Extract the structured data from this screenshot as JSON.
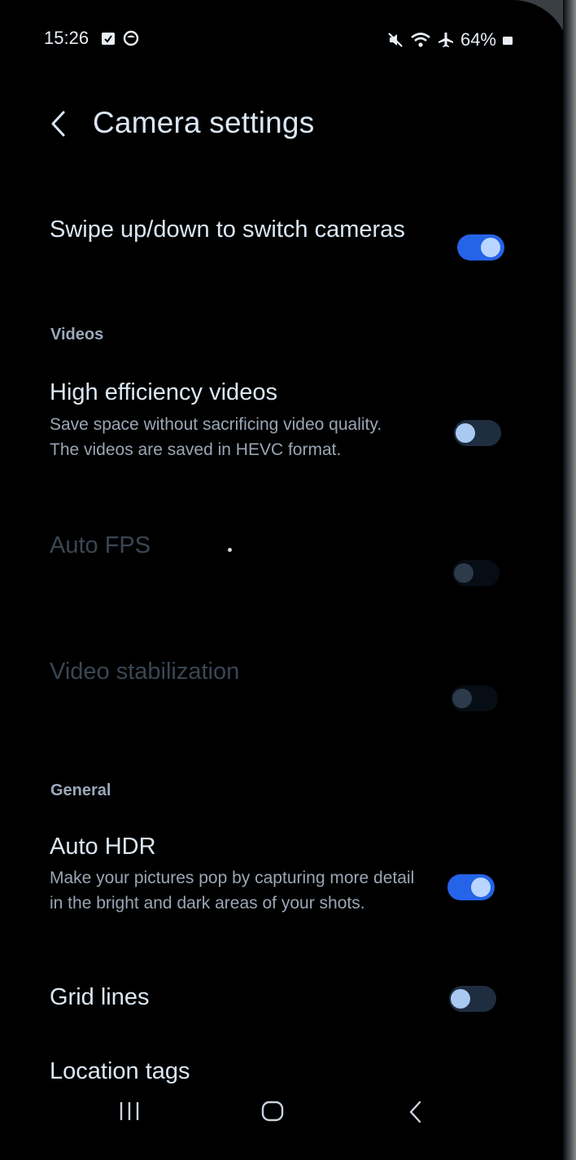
{
  "status_bar": {
    "time": "15:26",
    "battery_percent": "64%",
    "icons": [
      "calendar-check-icon",
      "notification-circle-icon",
      "mute-icon",
      "wifi-icon",
      "airplane-icon",
      "battery-icon"
    ]
  },
  "header": {
    "title": "Camera settings",
    "back_icon": "chevron-left-icon"
  },
  "settings": {
    "swipe_switch": {
      "title": "Swipe up/down to switch cameras",
      "enabled": true
    },
    "videos_section": "Videos",
    "high_efficiency": {
      "title": "High efficiency videos",
      "description": "Save space without sacrificing video quality. The videos are saved in HEVC format.",
      "enabled": false
    },
    "auto_fps": {
      "title": "Auto FPS",
      "enabled": false,
      "disabled": true
    },
    "video_stabilization": {
      "title": "Video stabilization",
      "enabled": false,
      "disabled": true
    },
    "general_section": "General",
    "auto_hdr": {
      "title": "Auto HDR",
      "description": "Make your pictures pop by capturing more detail in the bright and dark areas of your shots.",
      "enabled": true
    },
    "grid_lines": {
      "title": "Grid lines",
      "enabled": false
    },
    "location_tags": {
      "title": "Location tags"
    }
  },
  "nav_bar": {
    "icons": [
      "recent-apps-icon",
      "home-icon",
      "back-icon"
    ]
  },
  "colors": {
    "background": "#000000",
    "toggle_on": "#2563e9",
    "toggle_off": "#1f2d40",
    "text_primary": "#dbe7f4",
    "text_secondary": "#9aa6b4"
  }
}
